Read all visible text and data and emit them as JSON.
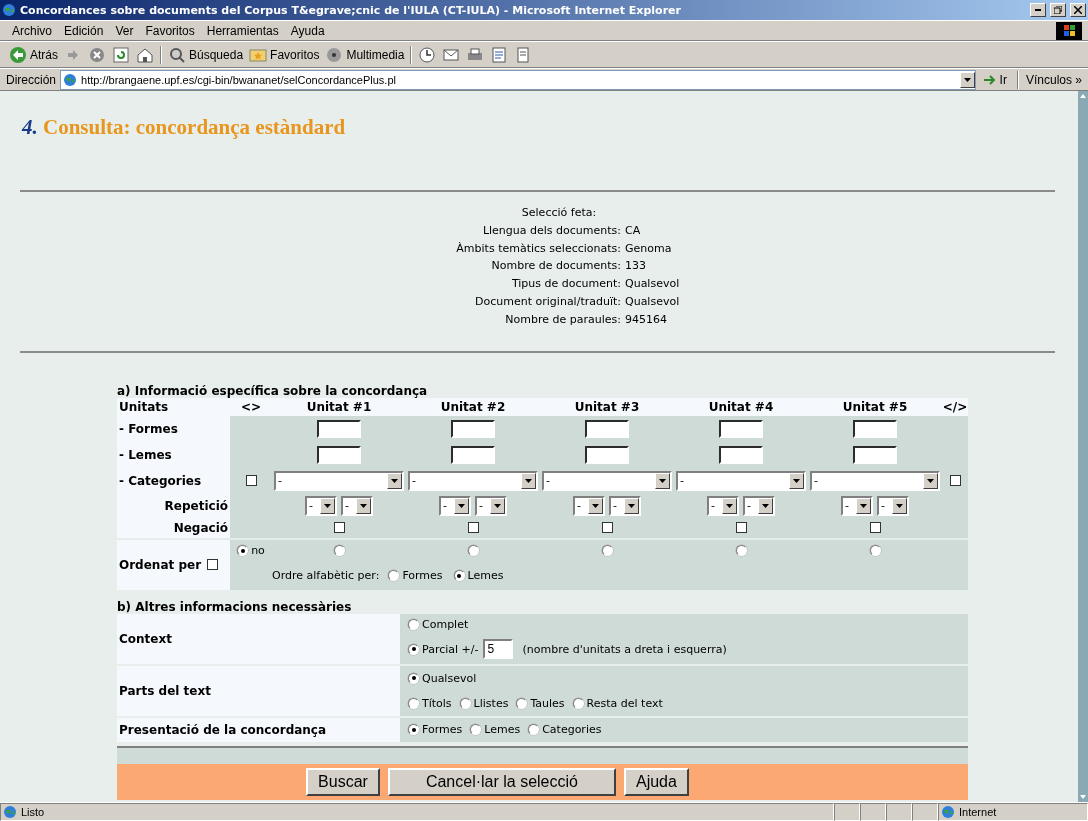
{
  "window": {
    "title": "Concordances sobre documents del Corpus T&egrave;cnic de l'IULA (CT-IULA) - Microsoft Internet Explorer"
  },
  "menu": [
    "Archivo",
    "Edición",
    "Ver",
    "Favoritos",
    "Herramientas",
    "Ayuda"
  ],
  "toolbar": [
    {
      "kind": "back",
      "label": "Atrás"
    },
    {
      "kind": "forward"
    },
    {
      "kind": "stop"
    },
    {
      "kind": "refresh"
    },
    {
      "kind": "home"
    },
    {
      "kind": "search",
      "label": "Búsqueda"
    },
    {
      "kind": "favorites",
      "label": "Favoritos"
    },
    {
      "kind": "media",
      "label": "Multimedia"
    },
    {
      "kind": "history"
    },
    {
      "kind": "mail"
    },
    {
      "kind": "print"
    },
    {
      "kind": "edit"
    },
    {
      "kind": "discuss"
    }
  ],
  "address": {
    "label": "Dirección",
    "url": "http://brangaene.upf.es/cgi-bin/bwananet/selConcordancePlus.pl",
    "go": "Ir",
    "links": "Vínculos »"
  },
  "heading": {
    "number": "4.",
    "title": "Consulta: concordança estàndard"
  },
  "selection": {
    "title": "Selecció feta:",
    "rows": [
      {
        "label": "Llengua dels documents:",
        "value": "CA"
      },
      {
        "label": "Àmbits temàtics seleccionats:",
        "value": "Genoma"
      },
      {
        "label": "Nombre de documents:",
        "value": "133"
      },
      {
        "label": "Tipus de document:",
        "value": "Qualsevol"
      },
      {
        "label": "Document original/traduït:",
        "value": "Qualsevol"
      },
      {
        "label": "Nombre de paraules:",
        "value": "945164"
      }
    ]
  },
  "section_a": {
    "title": "a) Informació específica sobre la concordança",
    "units_label": "Unitats",
    "open_tag": "<>",
    "close_tag": "</>",
    "row_labels": {
      "formes": "- Formes",
      "lemes": "- Lemes",
      "categories": "- Categories",
      "repetition": "Repetició",
      "negation": "Negació"
    },
    "categories_open_checked": false,
    "categories_close_checked": false,
    "units": [
      {
        "title": "Unitat #1",
        "category": "-",
        "repetition": [
          "-",
          "-"
        ],
        "negated": false,
        "order_selected": false
      },
      {
        "title": "Unitat #2",
        "category": "-",
        "repetition": [
          "-",
          "-"
        ],
        "negated": false,
        "order_selected": false
      },
      {
        "title": "Unitat #3",
        "category": "-",
        "repetition": [
          "-",
          "-"
        ],
        "negated": false,
        "order_selected": false
      },
      {
        "title": "Unitat #4",
        "category": "-",
        "repetition": [
          "-",
          "-"
        ],
        "negated": false,
        "order_selected": false
      },
      {
        "title": "Unitat #5",
        "category": "-",
        "repetition": [
          "-",
          "-"
        ],
        "negated": false,
        "order_selected": false
      }
    ],
    "order": {
      "label": "Ordenat per",
      "checked": false,
      "none_label": "no",
      "none_selected": true,
      "alpha_label": "Ordre alfabètic per:",
      "alpha_options": [
        {
          "label": "Formes",
          "selected": false
        },
        {
          "label": "Lemes",
          "selected": true
        }
      ]
    }
  },
  "section_b": {
    "title": "b) Altres informacions necessàries",
    "rows": [
      {
        "label": "Context",
        "lines": [
          [
            {
              "label": "Complet",
              "selected": false
            }
          ],
          [
            {
              "label": "Parcial +/-",
              "selected": true,
              "field": "5",
              "note": "(nombre d'unitats a dreta i esquerra)"
            }
          ]
        ]
      },
      {
        "label": "Parts del text",
        "lines": [
          [
            {
              "label": "Qualsevol",
              "selected": true
            }
          ],
          [
            {
              "label": "Títols",
              "selected": false
            },
            {
              "label": "Llistes",
              "selected": false
            },
            {
              "label": "Taules",
              "selected": false
            },
            {
              "label": "Resta del text",
              "selected": false
            }
          ]
        ]
      },
      {
        "label": "Presentació de la concordança",
        "lines": [
          [
            {
              "label": "Formes",
              "selected": true
            },
            {
              "label": "Lemes",
              "selected": false
            },
            {
              "label": "Categories",
              "selected": false
            }
          ]
        ]
      }
    ]
  },
  "buttons": [
    "Buscar",
    "Cancel·lar la selecció",
    "Ajuda"
  ],
  "status": {
    "text": "Listo",
    "zone": "Internet"
  }
}
